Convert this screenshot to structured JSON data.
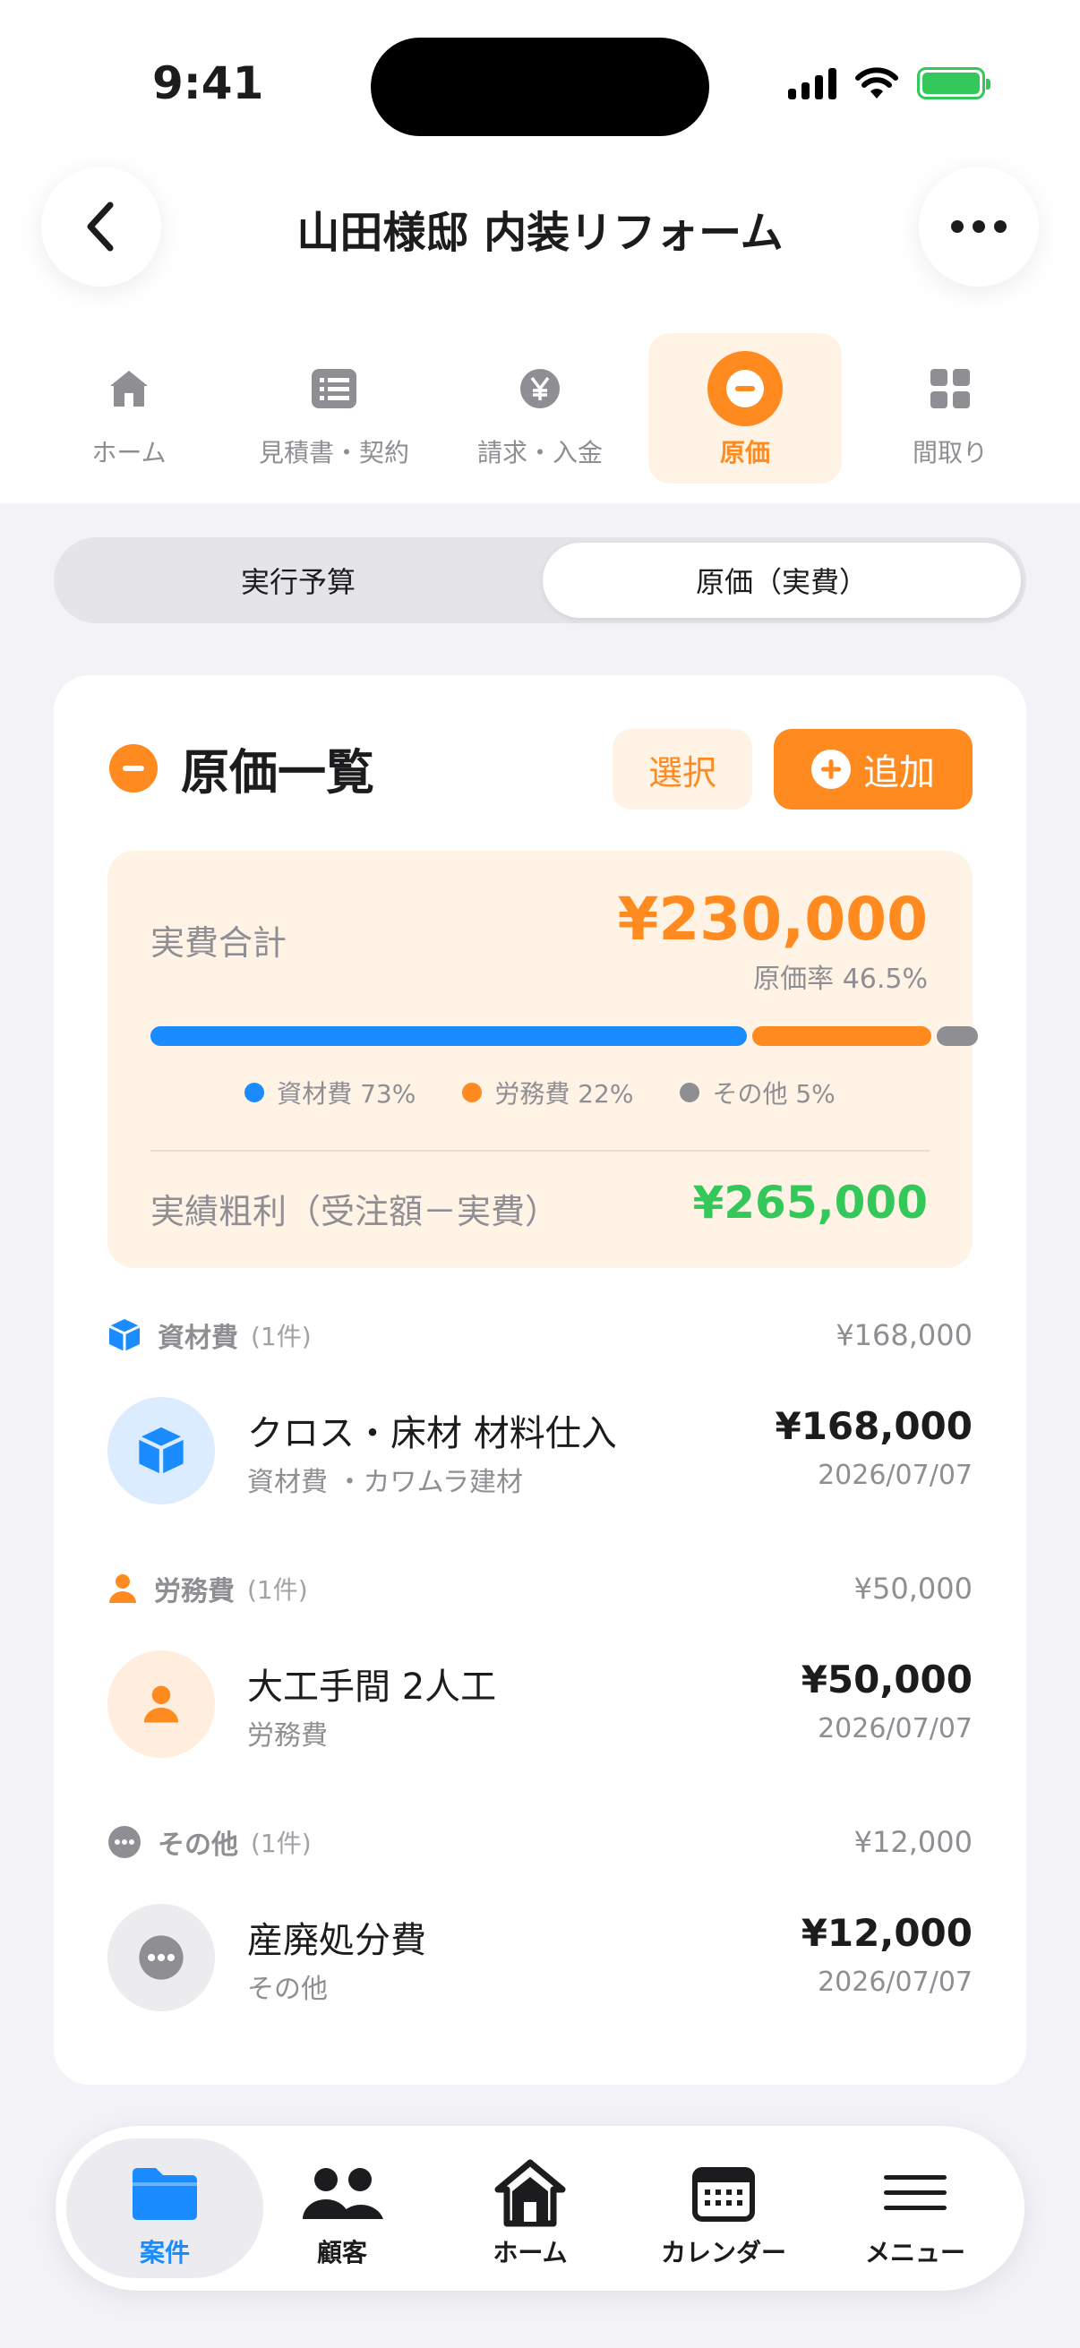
{
  "status_bar": {
    "time": "9:41"
  },
  "header": {
    "title": "山田様邸 内装リフォーム"
  },
  "tabs": [
    {
      "label": "ホーム",
      "icon": "house-icon"
    },
    {
      "label": "見積書・契約",
      "icon": "document-list-icon"
    },
    {
      "label": "請求・入金",
      "icon": "yen-icon"
    },
    {
      "label": "原価",
      "icon": "minus-circle-icon",
      "active": true
    },
    {
      "label": "間取り",
      "icon": "grid-icon"
    }
  ],
  "segment": {
    "left": "実行予算",
    "right": "原価（実費）",
    "selected": "right"
  },
  "card": {
    "title": "原価一覧",
    "select_label": "選択",
    "add_label": "追加"
  },
  "summary": {
    "label": "実費合計",
    "amount": "¥230,000",
    "rate": "原価率 46.5%",
    "breakdown": [
      {
        "label": "資材費 73%",
        "percent": 73,
        "color": "#1a8cff"
      },
      {
        "label": "労務費 22%",
        "percent": 22,
        "color": "#ff8a1f"
      },
      {
        "label": "その他 5%",
        "percent": 5,
        "color": "#8e8e93"
      }
    ],
    "profit_label": "実績粗利（受注額－実費）",
    "profit_amount": "¥265,000"
  },
  "groups": [
    {
      "name": "資材費",
      "count": "(1件)",
      "total": "¥168,000",
      "icon": "box-icon",
      "color": "#1a8cff",
      "items": [
        {
          "name": "クロス・床材 材料仕入",
          "sub": "資材費 ・カワムラ建材",
          "amount": "¥168,000",
          "date": "2026/07/07"
        }
      ]
    },
    {
      "name": "労務費",
      "count": "(1件)",
      "total": "¥50,000",
      "icon": "person-icon",
      "color": "#ff8a1f",
      "items": [
        {
          "name": "大工手間 2人工",
          "sub": "労務費",
          "amount": "¥50,000",
          "date": "2026/07/07"
        }
      ]
    },
    {
      "name": "その他",
      "count": "(1件)",
      "total": "¥12,000",
      "icon": "ellipsis-circle-icon",
      "color": "#8e8e93",
      "items": [
        {
          "name": "産廃処分費",
          "sub": "その他",
          "amount": "¥12,000",
          "date": "2026/07/07"
        }
      ]
    }
  ],
  "bottom_nav": [
    {
      "label": "案件",
      "icon": "folder-icon",
      "active": true
    },
    {
      "label": "顧客",
      "icon": "people-icon"
    },
    {
      "label": "ホーム",
      "icon": "home-icon"
    },
    {
      "label": "カレンダー",
      "icon": "calendar-icon"
    },
    {
      "label": "メニュー",
      "icon": "menu-icon"
    }
  ]
}
